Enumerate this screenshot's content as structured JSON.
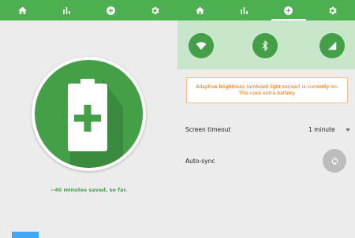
{
  "tabs": [
    {
      "icon": "home-icon",
      "active": false
    },
    {
      "icon": "bar-chart-icon",
      "active": false
    },
    {
      "icon": "add-circle-icon",
      "active": false
    },
    {
      "icon": "gear-icon",
      "active": false
    },
    {
      "icon": "home-icon",
      "active": false
    },
    {
      "icon": "bar-chart-icon",
      "active": false
    },
    {
      "icon": "add-circle-icon",
      "active": true
    },
    {
      "icon": "gear-icon",
      "active": false
    }
  ],
  "saver": {
    "icon": "battery-plus-icon",
    "savings_text": "~40 minutes saved, so far."
  },
  "quick_toggles": [
    {
      "icon": "wifi-icon"
    },
    {
      "icon": "bluetooth-icon"
    },
    {
      "icon": "cellular-signal-icon"
    }
  ],
  "alert": {
    "text": "Adaptive brightness (ambient light sensor) is currently on. This uses extra battery."
  },
  "settings": {
    "screen_timeout": {
      "label": "Screen timeout",
      "value": "1 minute"
    },
    "auto_sync": {
      "label": "Auto-sync",
      "icon": "sync-icon"
    }
  },
  "colors": {
    "primary": "#4caf50",
    "primary_dark": "#43a047",
    "quick_bar_bg": "#c8e6c9",
    "warning_text": "#ef6c00",
    "page_bg": "#ececec"
  }
}
